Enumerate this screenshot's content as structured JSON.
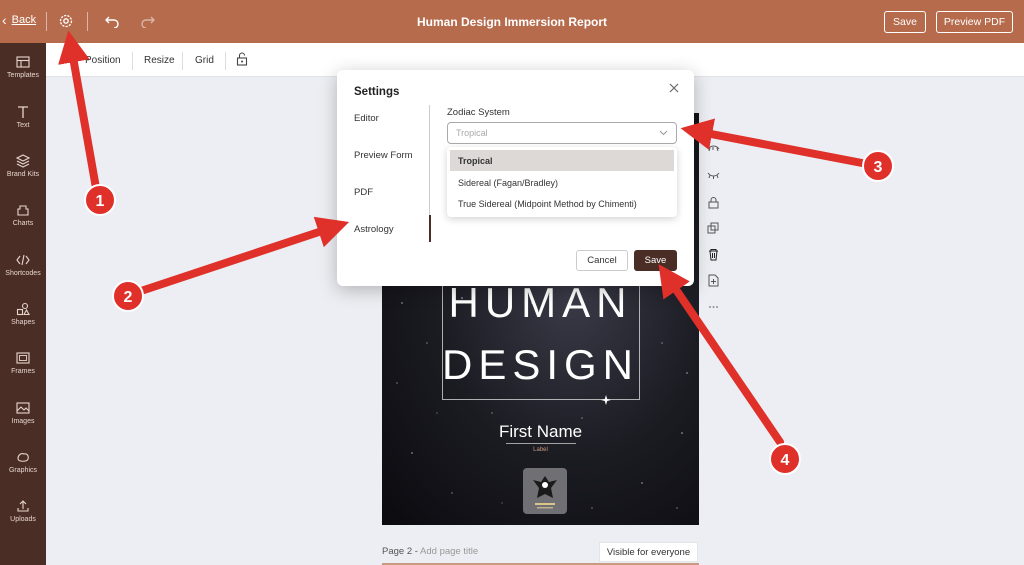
{
  "app": {
    "title": "Human Design Immersion Report",
    "back_label": "Back",
    "save_label": "Save",
    "preview_label": "Preview PDF",
    "accent": "#b66b4c",
    "sidebar_bg": "#4a2e26"
  },
  "sidebar": {
    "items": [
      {
        "label": "Templates",
        "icon": "templates-icon"
      },
      {
        "label": "Text",
        "icon": "text-icon"
      },
      {
        "label": "Brand Kits",
        "icon": "brand-kits-icon"
      },
      {
        "label": "Charts",
        "icon": "charts-icon"
      },
      {
        "label": "Shortcodes",
        "icon": "shortcodes-icon"
      },
      {
        "label": "Shapes",
        "icon": "shapes-icon"
      },
      {
        "label": "Frames",
        "icon": "frames-icon"
      },
      {
        "label": "Images",
        "icon": "images-icon"
      },
      {
        "label": "Graphics",
        "icon": "graphics-icon"
      },
      {
        "label": "Uploads",
        "icon": "uploads-icon"
      }
    ]
  },
  "toolbar": {
    "position": "Position",
    "resize": "Resize",
    "grid": "Grid"
  },
  "page": {
    "line1": "HUMAN",
    "line2": "DESIGN",
    "name": "First Name",
    "name_label": "Label"
  },
  "page2": {
    "label": "Page 2 - ",
    "placeholder": "Add page title",
    "visibility": "Visible for everyone"
  },
  "settings": {
    "title": "Settings",
    "nav": [
      "Editor",
      "Preview Form",
      "PDF",
      "Astrology"
    ],
    "active_nav": "Astrology",
    "field_label": "Zodiac System",
    "select_placeholder": "Tropical",
    "options": [
      "Tropical",
      "Sidereal (Fagan/Bradley)",
      "True Sidereal (Midpoint Method by Chimenti)"
    ],
    "selected_option": "Tropical",
    "cancel": "Cancel",
    "save": "Save"
  },
  "annotations": {
    "badges": [
      "1",
      "2",
      "3",
      "4"
    ],
    "color": "#e0302a"
  }
}
